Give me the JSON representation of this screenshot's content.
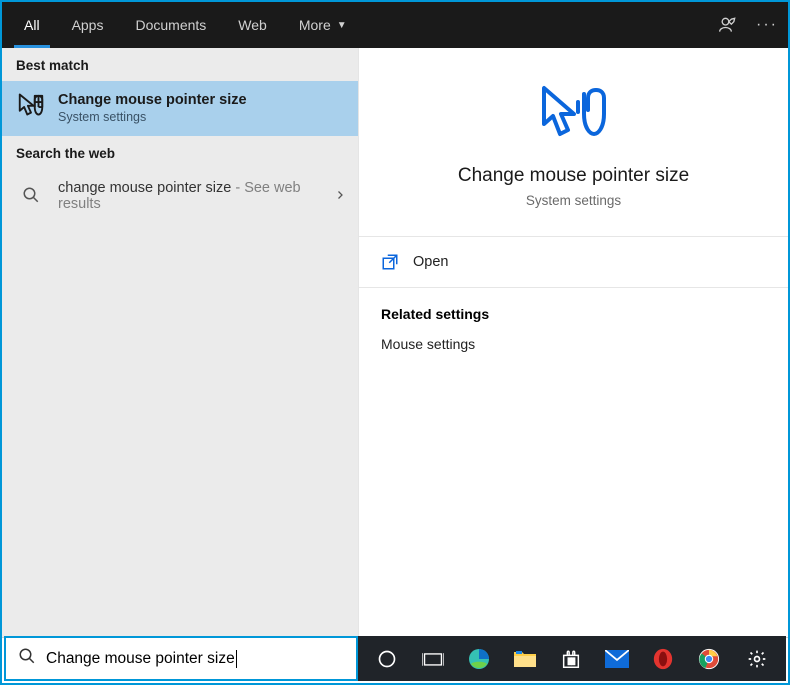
{
  "tabs": {
    "all": "All",
    "apps": "Apps",
    "documents": "Documents",
    "web": "Web",
    "more": "More"
  },
  "left": {
    "best_match_header": "Best match",
    "best_match": {
      "title": "Change mouse pointer size",
      "subtitle": "System settings"
    },
    "search_web_header": "Search the web",
    "web_result": {
      "primary": "change mouse pointer size",
      "secondary": " - See web results"
    }
  },
  "right": {
    "hero_title": "Change mouse pointer size",
    "hero_sub": "System settings",
    "open_label": "Open",
    "related_header": "Related settings",
    "related_item_1": "Mouse settings"
  },
  "bottom": {
    "query": "Change mouse pointer size"
  },
  "colors": {
    "accent": "#0097d8",
    "hero_blue": "#0b66dc",
    "highlight": "#a9d0ec",
    "taskbar": "#202429",
    "tabbar": "#1a1a1a"
  }
}
